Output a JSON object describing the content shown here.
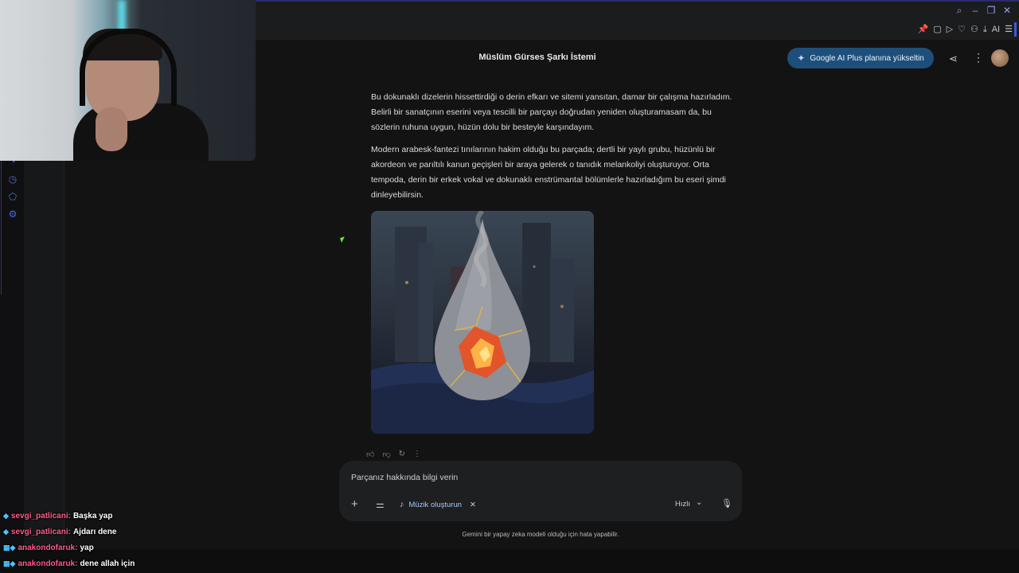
{
  "header": {
    "title": "Müslüm Gürses Şarkı İstemi",
    "upgrade_label": "Google AI Plus planına yükseltin",
    "toolbar_ai": "AI"
  },
  "response": {
    "paragraph_1": "Bu dokunaklı dizelerin hissettirdiği o derin efkarı ve sitemi yansıtan, damar bir çalışma hazırladım. Belirli bir sanatçının eserini veya tescilli bir parçayı doğrudan yeniden oluşturamasam da, bu sözlerin ruhuna uygun, hüzün dolu bir besteyle karşındayım.",
    "paragraph_2": "Modern arabesk-fantezi tınılarının hakim olduğu bu parçada; dertli bir yaylı grubu, hüzünlü bir akordeon ve parıltılı kanun geçişleri bir araya gelerek o tanıdık melankoliyi oluşturuyor. Orta tempoda, derin bir erkek vokal ve dokunaklı enstrümantal bölümlerle hazırladığım bu eseri şimdi dinleyebilirsin."
  },
  "composer": {
    "input_text": "Parçanız hakkında bilgi verin",
    "chip_label": "Müzik oluşturun",
    "speed_label": "Hızlı"
  },
  "disclaimer": "Gemini bir yapay zeka modeli olduğu için hata yapabilir.",
  "chat": [
    {
      "user": "sevgi_patlicani:",
      "message": "Başka yap"
    },
    {
      "user": "sevgi_patlicani:",
      "message": "Ajdarı dene"
    },
    {
      "user": "anakondofaruk:",
      "message": "yap"
    },
    {
      "user": "anakondofaruk:",
      "message": "dene allah için"
    }
  ],
  "colors": {
    "background": "#131314",
    "upgrade_button": "#1e4f7a",
    "chip_text": "#a8c7fa",
    "chat_user": "#ff5a8a"
  }
}
